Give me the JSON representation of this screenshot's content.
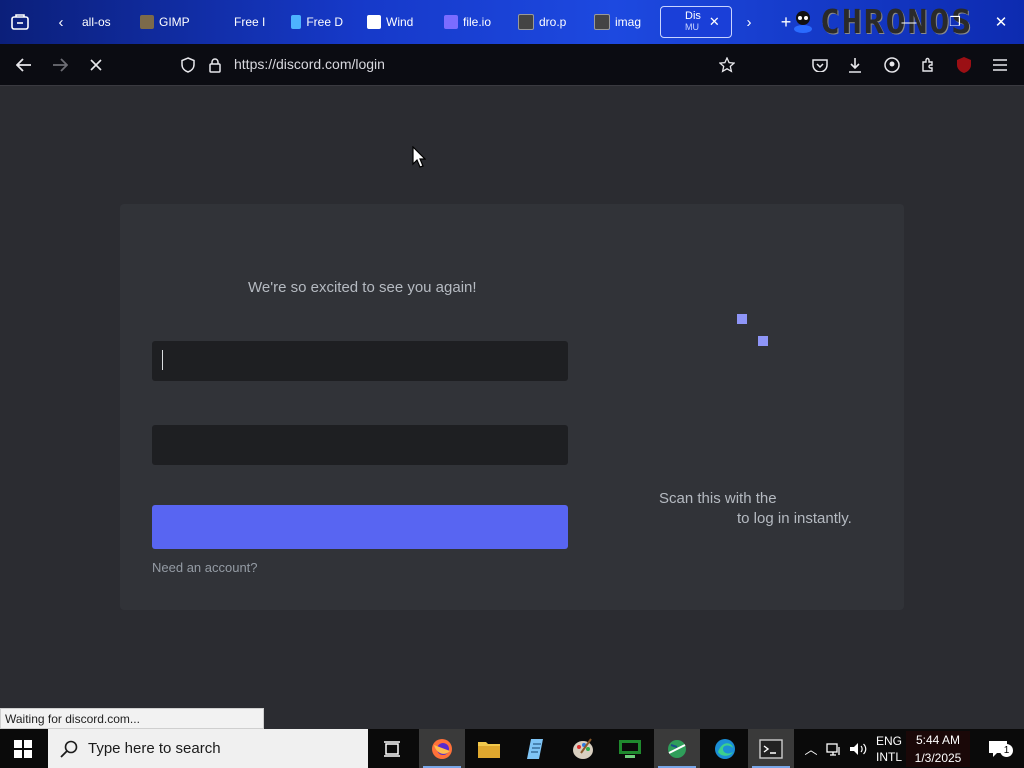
{
  "browser": {
    "tabs": [
      {
        "label": "all-os",
        "color": "#1d49e0"
      },
      {
        "label": "GIMP",
        "color": "#7c6a4a"
      },
      {
        "label": "Free I",
        "color": "#1d49e0"
      },
      {
        "label": "Free D",
        "color": "#4db3ff"
      },
      {
        "label": "Wind",
        "color": "#ffffff"
      },
      {
        "label": "file.io",
        "color": "#7b6cff"
      },
      {
        "label": "dro.p",
        "color": "#444444"
      },
      {
        "label": "imag",
        "color": "#444444"
      }
    ],
    "active_tab": {
      "label_top": "Dis",
      "label_bottom": "MU"
    },
    "logo_text": "CHRONOS",
    "url": "https://discord.com/login"
  },
  "page": {
    "welcome": "We're so excited to see you again!",
    "register_link": "Need an account?",
    "scan_line1": "Scan this with the",
    "scan_line2": "to log in instantly."
  },
  "status_bar": "Waiting for discord.com...",
  "taskbar": {
    "search_placeholder": "Type here to search",
    "language": "ENG",
    "layout": "INTL",
    "time": "5:44 AM",
    "date": "1/3/2025",
    "notification_count": "1"
  },
  "colors": {
    "accent": "#5865f2",
    "background": "#2b2c31",
    "card": "#313338"
  }
}
